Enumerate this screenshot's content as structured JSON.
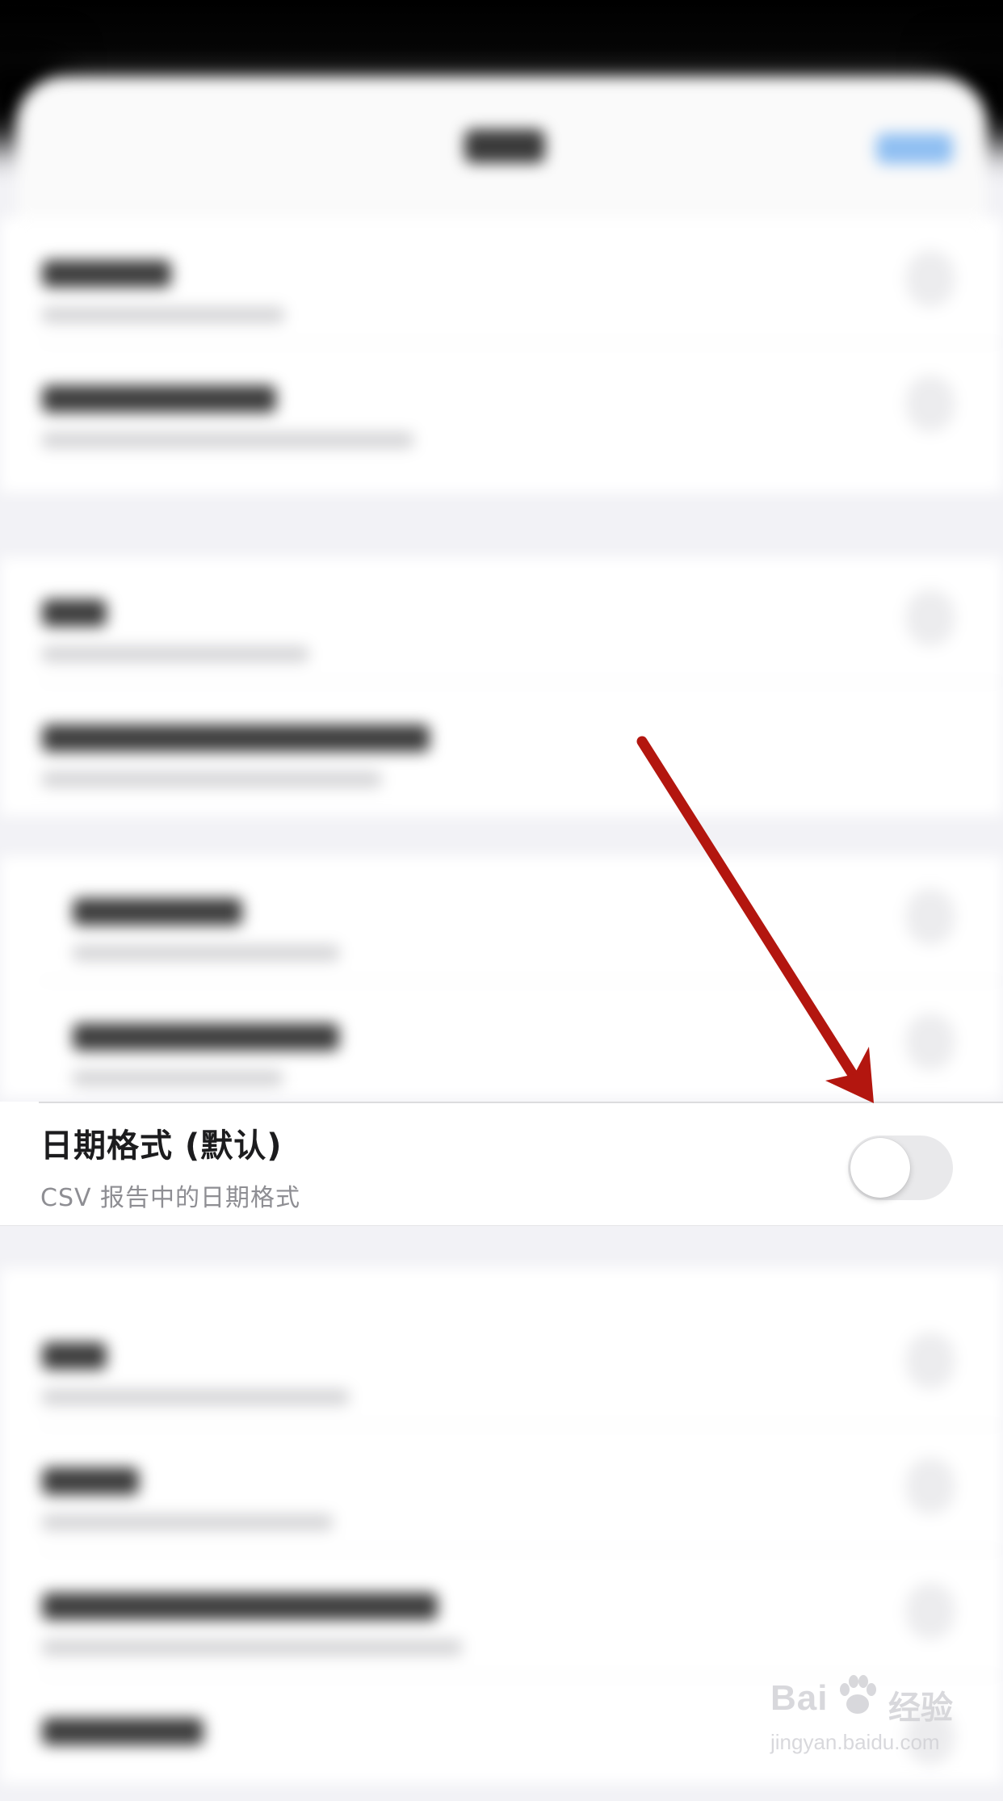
{
  "setting": {
    "title": "日期格式 (默认)",
    "subtitle": "CSV 报告中的日期格式",
    "toggle_on": false
  },
  "watermark": {
    "brand": "Bai",
    "brand_cn": "经验",
    "url": "jingyan.baidu.com"
  },
  "colors": {
    "annotation_arrow": "#b3160f",
    "toggle_off_track": "#e9e9eb"
  },
  "icons": {
    "arrow": "red-arrow-annotation",
    "watermark_logo": "baidu-paw-icon"
  }
}
